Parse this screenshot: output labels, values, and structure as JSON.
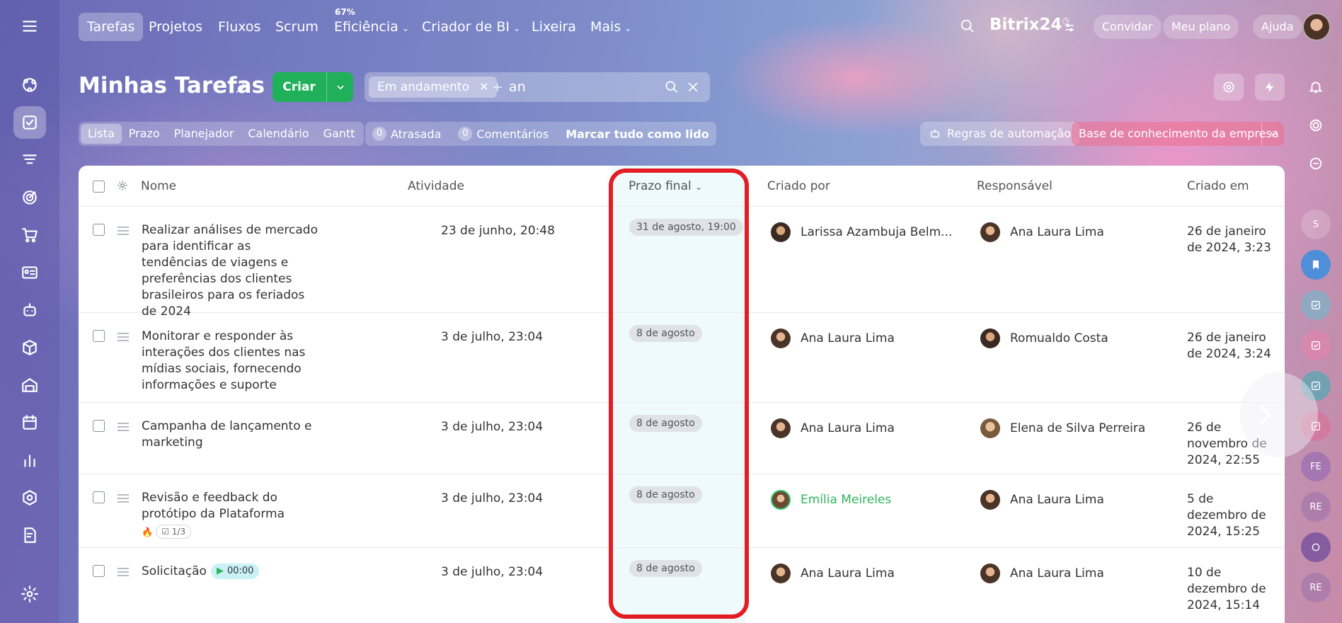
{
  "nav": {
    "items": [
      "Tarefas",
      "Projetos",
      "Fluxos",
      "Scrum",
      "Eficiência",
      "Criador de BI",
      "Lixeira",
      "Mais"
    ],
    "efficiency_badge": "67%",
    "brand": "Bitrix",
    "brand_num": "24",
    "invite": "Convidar",
    "plan": "Meu plano",
    "help": "Ajuda"
  },
  "page": {
    "title": "Minhas Tarefas",
    "create": "Criar",
    "filter_chip": "Em andamento",
    "search_plus": "+",
    "search_value": "an"
  },
  "views": [
    "Lista",
    "Prazo",
    "Planejador",
    "Calendário",
    "Gantt"
  ],
  "counters": {
    "overdue_count": "0",
    "overdue": "Atrasada",
    "comments_count": "0",
    "comments": "Comentários",
    "mark_all": "Marcar tudo como lido"
  },
  "automation": "Regras de automação",
  "knowledge": "Base de conhecimento da empresa",
  "columns": {
    "name": "Nome",
    "activity": "Atividade",
    "deadline": "Prazo final",
    "created_by": "Criado por",
    "responsible": "Responsável",
    "created_on": "Criado em"
  },
  "rows": [
    {
      "name": "Realizar análises de mercado para identificar as tendências de viagens e preferências dos clientes brasileiros para os feriados de 2024",
      "activity": "23 de junho, 20:48",
      "deadline": "31 de agosto, 19:00",
      "created_by": "Larissa Azambuja Belm...",
      "responsible": "Ana Laura Lima",
      "created_on": "26 de janeiro de 2024, 3:23"
    },
    {
      "name": "Monitorar e responder às interações dos clientes nas mídias sociais, fornecendo informações e suporte",
      "activity": "3 de julho, 23:04",
      "deadline": "8 de agosto",
      "created_by": "Ana Laura Lima",
      "responsible": "Romualdo Costa",
      "created_on": "26 de janeiro de 2024, 3:24"
    },
    {
      "name": "Campanha de lançamento e marketing",
      "activity": "3 de julho, 23:04",
      "deadline": "8 de agosto",
      "created_by": "Ana Laura Lima",
      "responsible": "Elena de Silva Perreira",
      "created_on": "26 de novembro de 2024, 22:55"
    },
    {
      "name": "Revisão e feedback do protótipo da Plataforma",
      "activity": "3 de julho, 23:04",
      "deadline": "8 de agosto",
      "created_by": "Emília Meireles",
      "responsible": "Ana Laura Lima",
      "created_on": "5 de dezembro de 2024, 15:25",
      "checklist": "1/3"
    },
    {
      "name": "Solicitação",
      "activity": "3 de julho, 23:04",
      "deadline": "8 de agosto",
      "created_by": "Ana Laura Lima",
      "responsible": "Ana Laura Lima",
      "created_on": "10 de dezembro de 2024, 15:14",
      "timer": "00:00"
    }
  ],
  "right_avatars": [
    "S",
    "FE",
    "RE",
    "RE"
  ],
  "colors": {
    "accent_green": "#20b05a",
    "highlight": "#e31d23",
    "deadline_col": "#eefafc"
  }
}
